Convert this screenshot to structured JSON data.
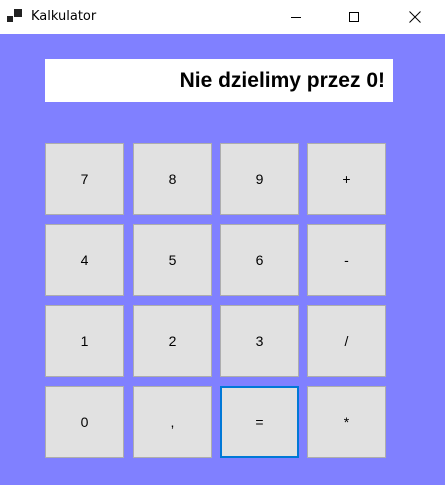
{
  "window": {
    "title": "Kalkulator",
    "icon": "app-window-icon",
    "controls": [
      "minimize-icon",
      "maximize-icon",
      "close-icon"
    ],
    "background_color": "#8080ff"
  },
  "display": {
    "text": "Nie dzielimy przez 0!"
  },
  "keypad": {
    "rows": [
      [
        "7",
        "8",
        "9",
        "+"
      ],
      [
        "4",
        "5",
        "6",
        "-"
      ],
      [
        "1",
        "2",
        "3",
        "/"
      ],
      [
        "0",
        ",",
        "=",
        "*"
      ]
    ],
    "focused_key": "="
  },
  "colors": {
    "accent_focus": "#0078d7",
    "button_face": "#e1e1e1"
  }
}
